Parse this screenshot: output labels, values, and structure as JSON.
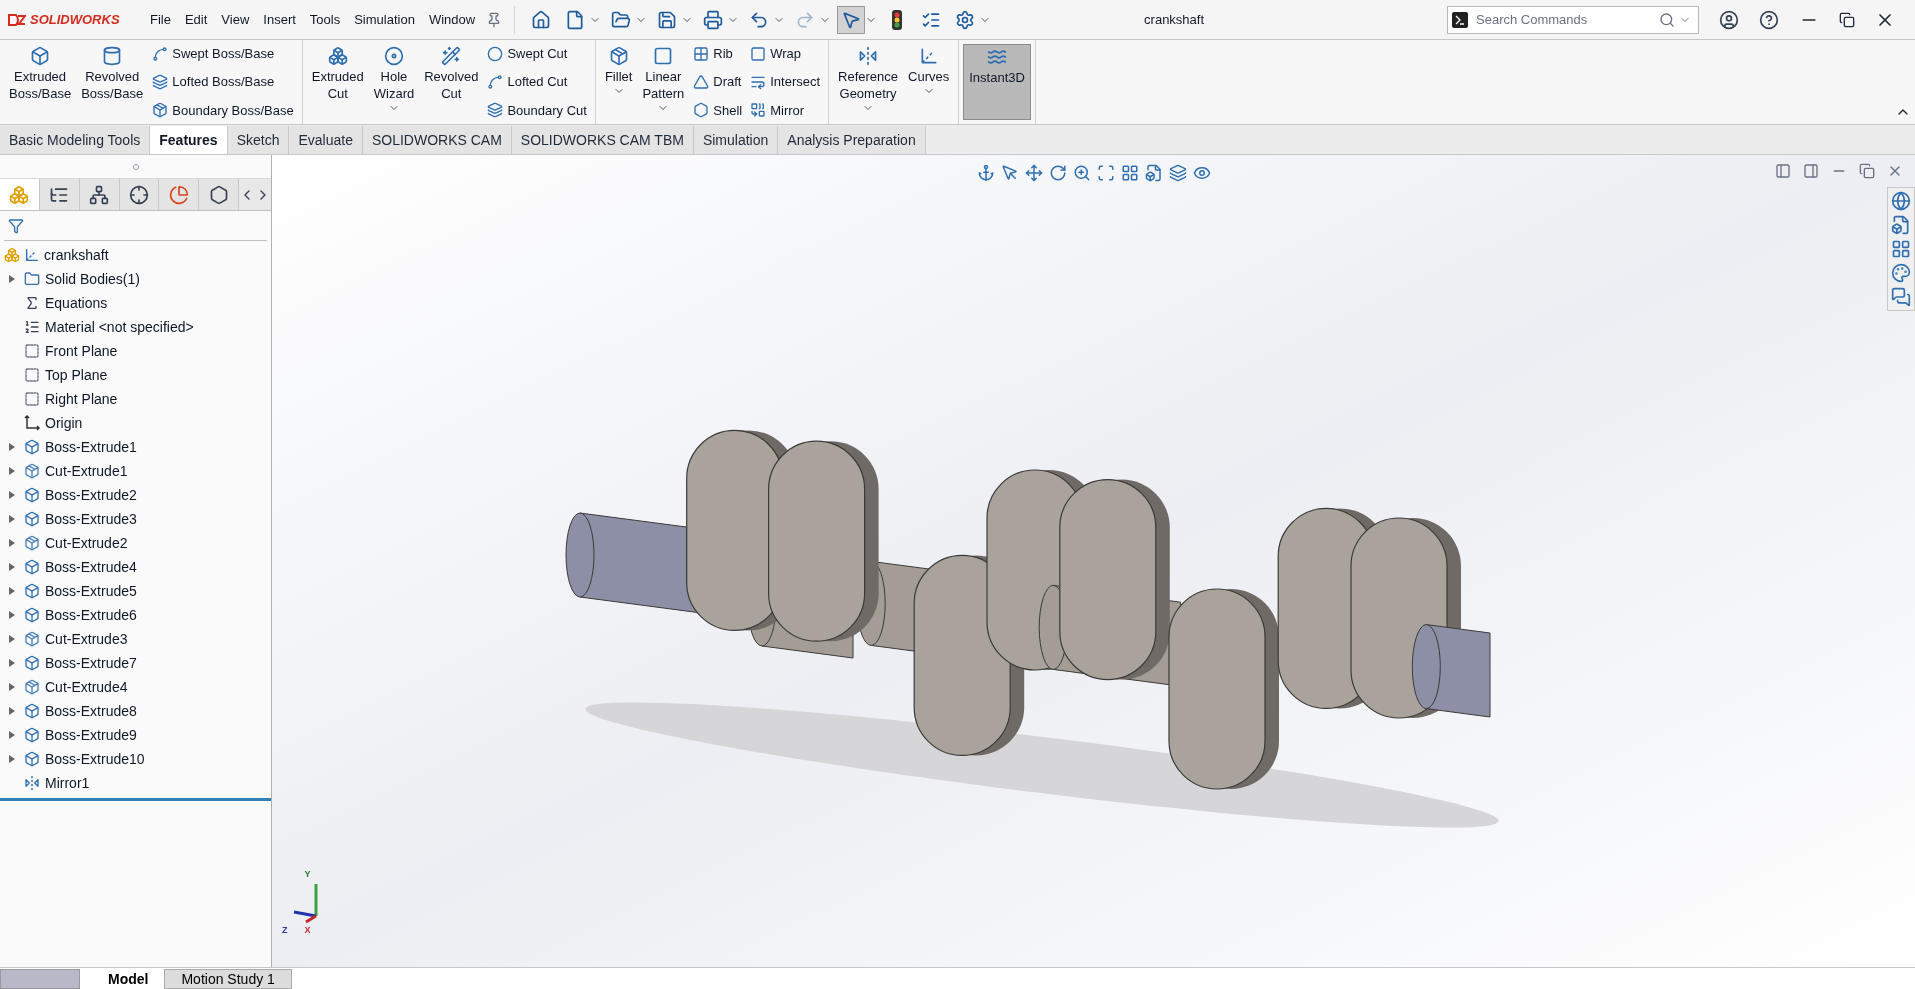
{
  "app": {
    "logo": "SOLIDWORKS",
    "title": "crankshaft"
  },
  "menu": [
    "File",
    "Edit",
    "View",
    "Insert",
    "Tools",
    "Simulation",
    "Window"
  ],
  "quick_access": [
    {
      "selected": false,
      "disabled": false
    },
    {
      "selected": false,
      "disabled": false
    },
    {
      "selected": false,
      "disabled": false
    },
    {
      "selected": false,
      "disabled": false
    },
    {
      "selected": false,
      "disabled": false
    },
    {
      "selected": false,
      "disabled": false
    },
    {
      "selected": false,
      "disabled": true
    },
    {
      "selected": true,
      "disabled": false
    },
    {
      "selected": false,
      "disabled": false
    },
    {
      "selected": false,
      "disabled": false
    },
    {
      "selected": false,
      "disabled": false
    }
  ],
  "search": {
    "placeholder": "Search Commands"
  },
  "ribbon": [
    {
      "items": [
        {
          "kind": "large",
          "lines": [
            "Extruded",
            "Boss/Base"
          ],
          "active": false,
          "dropdown": false
        },
        {
          "kind": "large",
          "lines": [
            "Revolved",
            "Boss/Base"
          ],
          "active": false,
          "dropdown": false
        },
        {
          "kind": "stack",
          "labels": [
            "Swept Boss/Base",
            "Lofted Boss/Base",
            "Boundary Boss/Base"
          ]
        }
      ]
    },
    {
      "items": [
        {
          "kind": "large",
          "lines": [
            "Extruded",
            "Cut"
          ],
          "active": false,
          "dropdown": false
        },
        {
          "kind": "large",
          "lines": [
            "Hole",
            "Wizard"
          ],
          "active": false,
          "dropdown": true
        },
        {
          "kind": "large",
          "lines": [
            "Revolved",
            "Cut"
          ],
          "active": false,
          "dropdown": false
        },
        {
          "kind": "stack",
          "labels": [
            "Swept Cut",
            "Lofted Cut",
            "Boundary Cut"
          ]
        }
      ]
    },
    {
      "items": [
        {
          "kind": "large",
          "lines": [
            "Fillet"
          ],
          "active": false,
          "dropdown": true
        },
        {
          "kind": "large",
          "lines": [
            "Linear",
            "Pattern"
          ],
          "active": false,
          "dropdown": true
        },
        {
          "kind": "stack",
          "labels": [
            "Rib",
            "Draft",
            "Shell"
          ]
        },
        {
          "kind": "stack",
          "labels": [
            "Wrap",
            "Intersect",
            "Mirror"
          ]
        }
      ]
    },
    {
      "items": [
        {
          "kind": "large",
          "lines": [
            "Reference",
            "Geometry"
          ],
          "active": false,
          "dropdown": true
        },
        {
          "kind": "large",
          "lines": [
            "Curves"
          ],
          "active": false,
          "dropdown": true
        }
      ]
    },
    {
      "items": [
        {
          "kind": "large",
          "lines": [
            "Instant3D"
          ],
          "active": true,
          "dropdown": false
        }
      ]
    }
  ],
  "command_tabs": [
    {
      "label": "Basic Modeling Tools",
      "selected": false
    },
    {
      "label": "Features",
      "selected": true
    },
    {
      "label": "Sketch",
      "selected": false
    },
    {
      "label": "Evaluate",
      "selected": false
    },
    {
      "label": "SOLIDWORKS CAM",
      "selected": false
    },
    {
      "label": "SOLIDWORKS CAM TBM",
      "selected": false
    },
    {
      "label": "Simulation",
      "selected": false
    },
    {
      "label": "Analysis Preparation",
      "selected": false
    }
  ],
  "panel_tabs": [
    {
      "selected": true
    },
    {
      "selected": false
    },
    {
      "selected": false
    },
    {
      "selected": false
    },
    {
      "selected": false
    },
    {
      "selected": false
    }
  ],
  "tree": {
    "root": "crankshaft",
    "items": [
      {
        "label": "Solid Bodies(1)",
        "kind": "folder",
        "expandable": true
      },
      {
        "label": "Equations",
        "kind": "equations",
        "expandable": false
      },
      {
        "label": "Material <not specified>",
        "kind": "material",
        "expandable": false
      },
      {
        "label": "Front Plane",
        "kind": "plane",
        "expandable": false
      },
      {
        "label": "Top Plane",
        "kind": "plane",
        "expandable": false
      },
      {
        "label": "Right Plane",
        "kind": "plane",
        "expandable": false
      },
      {
        "label": "Origin",
        "kind": "origin",
        "expandable": false
      },
      {
        "label": "Boss-Extrude1",
        "kind": "boss",
        "expandable": true
      },
      {
        "label": "Cut-Extrude1",
        "kind": "cut",
        "expandable": true
      },
      {
        "label": "Boss-Extrude2",
        "kind": "boss",
        "expandable": true
      },
      {
        "label": "Boss-Extrude3",
        "kind": "boss",
        "expandable": true
      },
      {
        "label": "Cut-Extrude2",
        "kind": "cut",
        "expandable": true
      },
      {
        "label": "Boss-Extrude4",
        "kind": "boss",
        "expandable": true
      },
      {
        "label": "Boss-Extrude5",
        "kind": "boss",
        "expandable": true
      },
      {
        "label": "Boss-Extrude6",
        "kind": "boss",
        "expandable": true
      },
      {
        "label": "Cut-Extrude3",
        "kind": "cut",
        "expandable": true
      },
      {
        "label": "Boss-Extrude7",
        "kind": "boss",
        "expandable": true
      },
      {
        "label": "Cut-Extrude4",
        "kind": "cut",
        "expandable": true
      },
      {
        "label": "Boss-Extrude8",
        "kind": "boss",
        "expandable": true
      },
      {
        "label": "Boss-Extrude9",
        "kind": "boss",
        "expandable": true
      },
      {
        "label": "Boss-Extrude10",
        "kind": "boss",
        "expandable": true
      },
      {
        "label": "Mirror1",
        "kind": "mirror",
        "expandable": false
      }
    ]
  },
  "triad": {
    "y": "Y",
    "z": "Z",
    "x": "X"
  },
  "bottom_tabs": [
    {
      "label": "Model",
      "selected": true
    },
    {
      "label": "Motion Study 1",
      "selected": false
    }
  ]
}
